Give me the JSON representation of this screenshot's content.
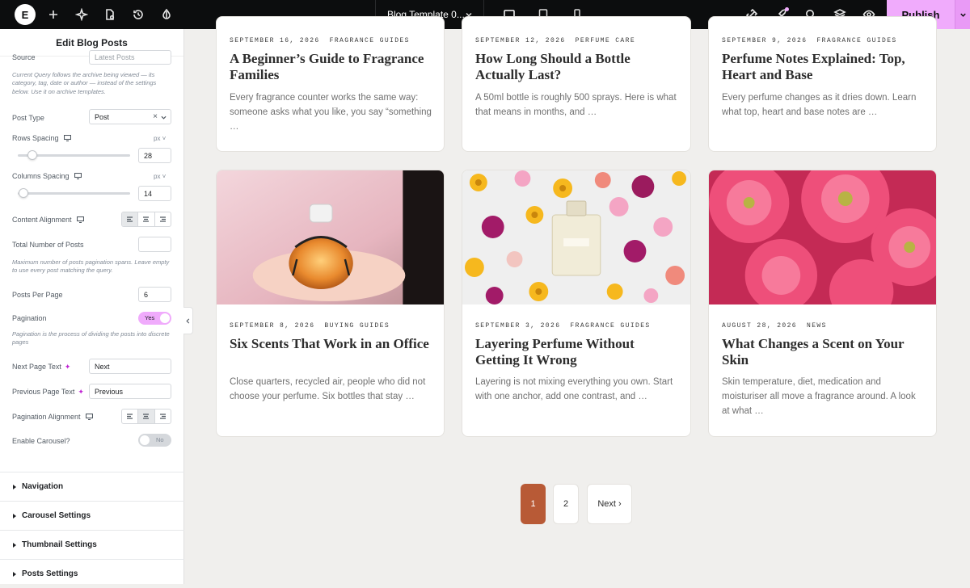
{
  "topbar": {
    "logo": "E",
    "template_title": "Blog Template 0...",
    "publish_label": "Publish"
  },
  "sidebar": {
    "header": "Edit Blog Posts",
    "source_value": "Latest Posts",
    "query_note": "Current Query follows the archive being viewed — its category, tag, date or author — instead of the settings below. Use it on archive templates.",
    "post_type_label": "Post Type",
    "post_type_value": "Post",
    "rows_spacing_label": "Rows Spacing",
    "rows_spacing_value": "28",
    "rows_spacing_fraction": 0.13,
    "columns_spacing_label": "Columns Spacing",
    "columns_spacing_value": "14",
    "columns_spacing_fraction": 0.05,
    "unit": "px",
    "content_alignment_label": "Content Alignment",
    "total_posts_label": "Total Number of Posts",
    "total_posts_value": "",
    "total_posts_note": "Maximum number of posts pagination spans. Leave empty to use every post matching the query.",
    "posts_per_page_label": "Posts Per Page",
    "posts_per_page_value": "6",
    "pagination_label": "Pagination",
    "pagination_toggle": "Yes",
    "pagination_note": "Pagination is the process of dividing the posts into discrete pages",
    "next_text_label": "Next Page Text",
    "next_text_value": "Next",
    "prev_text_label": "Previous Page Text",
    "prev_text_value": "Previous",
    "pagination_alignment_label": "Pagination Alignment",
    "carousel_label": "Enable Carousel?",
    "carousel_toggle": "No",
    "sections": [
      "Navigation",
      "Carousel Settings",
      "Thumbnail Settings",
      "Posts Settings"
    ]
  },
  "posts": [
    {
      "date": "September 16, 2026",
      "category": "Fragrance Guides",
      "title": "A Beginner’s Guide to Fragrance Families",
      "excerpt": "Every fragrance counter works the same way: someone asks what you like, you say “something …"
    },
    {
      "date": "September 12, 2026",
      "category": "Perfume Care",
      "title": "How Long Should a Bottle Actually Last?",
      "excerpt": "A 50ml bottle is roughly 500 sprays. Here is what that means in months, and …"
    },
    {
      "date": "September 9, 2026",
      "category": "Fragrance Guides",
      "title": "Perfume Notes Explained: Top, Heart and Base",
      "excerpt": "Every perfume changes as it dries down. Learn what top, heart and base notes are …"
    },
    {
      "date": "September 8, 2026",
      "category": "Buying Guides",
      "title": "Six Scents That Work in an Office",
      "excerpt": "Close quarters, recycled air, people who did not choose your perfume. Six bottles that stay …"
    },
    {
      "date": "September 3, 2026",
      "category": "Fragrance Guides",
      "title": "Layering Perfume Without Getting It Wrong",
      "excerpt": "Layering is not mixing everything you own. Start with one anchor, add one contrast, and …"
    },
    {
      "date": "August 28, 2026",
      "category": "News",
      "title": "What Changes a Scent on Your Skin",
      "excerpt": "Skin temperature, diet, medication and moisturiser all move a fragrance around. A look at what …"
    }
  ],
  "pagination": {
    "page1": "1",
    "page2": "2",
    "next": "Next ›"
  },
  "colors": {
    "accent": "#f0abfc",
    "pager_active": "#b85a36"
  }
}
